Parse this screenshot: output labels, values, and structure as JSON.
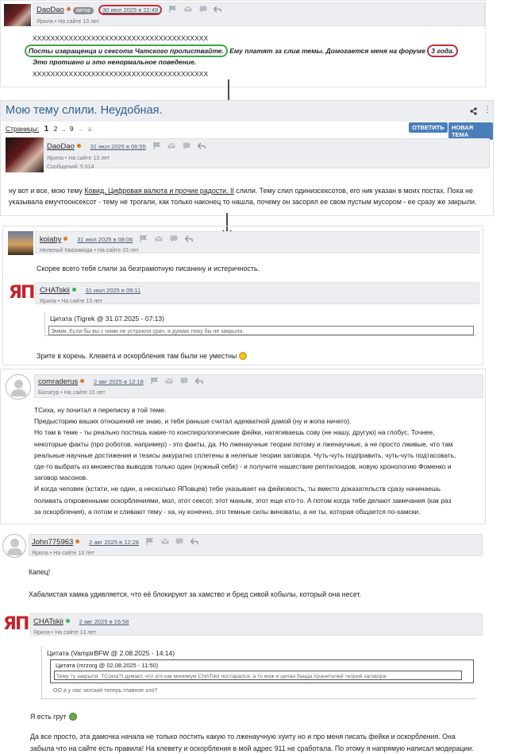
{
  "post1": {
    "username": "DaoDao",
    "badge": "автор",
    "date": "30 июл 2025 в 22:49",
    "rank": "Ярила",
    "member_since": "На сайте 13 лет",
    "x_line_1": "XXXXXXXXXXXXXXXXXXXXXXXXXXXXXXXXXXXXXXX",
    "text_circled": "Посты извращенца и сексота Чатского пролиствайте.",
    "text_rest": " Ему платят за слив темы. Домогается меня на форуме ",
    "text_circled_2": "3 года.",
    "text_line_2": "Это противно и это ненормальное поведение.",
    "x_line_2": "XXXXXXXXXXXXXXXXXXXXXXXXXXXXXXXXXXXXXXX"
  },
  "topic": {
    "title": "Мою тему слили. Неудобная.",
    "pages_label": "Страницы:",
    "page_current": "1",
    "page_2": "2",
    "page_dots": "..",
    "page_last": "9",
    "reply_button": "ОТВЕТИТЬ",
    "new_topic_button": "НОВАЯ ТЕМА"
  },
  "post2": {
    "username": "DaoDao",
    "date": "31 июл 2025 в 06:55",
    "rank": "Ярила",
    "member_since": "На сайте 13 лет",
    "messages": "Сообщений: 5 614",
    "text_before_link": "ну вот и все, мою тему ",
    "link": "Ковид, Цифровая валюта и прочие радости. II",
    "text_after_link": " слили. Тему слил одинизсексотов, его ник указан в моих постах. Пока не",
    "text_line_2": "указывала емучтоонсексот - тему не трогали, как только наконец то нашла, почему он засорял ее свом пустым мусором - ее сразу же закрыли."
  },
  "post3": {
    "username": "koiaby",
    "date": "31 июл 2025 в 08:06",
    "rank": "Нелепый Квазимода",
    "member_since": "На сайте 15 лет",
    "text": "Скорее всего тебя слили за безграмотную писанину и истеричность."
  },
  "post4": {
    "username": "CHATskii",
    "date": "31 июл 2025 в 09:11",
    "rank": "Ярила",
    "member_since": "На сайте 13 лет",
    "avatar_text": "ЯП",
    "quote_header": "Цитата (Tigrek @ 31.07.2025 - 07:13)",
    "quote_text": "Эммм. Если бы вы с ними не устроили срач, я думаю тему бы не закрыли.",
    "text": "Зрите в корень. Клевета и оскорбления там были не уместны"
  },
  "post5": {
    "username": "comraderus",
    "date": "2 авг 2025 в 12:18",
    "rank": "Балагур",
    "member_since": "На сайте 10 лет",
    "lines": [
      "ТСиха, ну почитал я переписку в той теме.",
      "Предысторию ваших отношений не знаю, и тебя раньше считал адекватной дамой (ну и жопа ничего).",
      "Но там в теме - ты реально постишь какие-то конспирологические фейки, натягиваешь сову (не нашу, другую) на глобус. Точнее,",
      "некоторые факты (про роботов, например) - это факты, да. Но лженаучные теории потому и лженаучные, а не просто лживые, что там",
      "реальные научные достижения и тезисы аккуратно сплетены в нелепые теории заговора. Чуть-чуть подправить, чуть-чуть подтасовать,",
      "где-то выбрать из множества выводов только один (нужный себе) - и получите нашествие рептилоидов, новую хронологию Фоменко и",
      "заговор масонов.",
      "И когда человек (кстати, не один, а несколько ЯПовцев) тебе указывает на фейковость, ты вместо доказательств сразу начинаешь",
      "поливать откровенными оскорблениями, мол, этот сексот, этот маньяк, этот еще кто-то. А потом когда тебе делают замечания (как раз",
      "за оскорбления), а потом и сливают тему - ха, ну конечно, это темные силы виноваты, а не ты, которая общается по-хамски."
    ]
  },
  "post6": {
    "username": "John775963",
    "date": "2 авг 2025 в 12:28",
    "rank": "Ярила",
    "member_since": "На сайте 13 лет",
    "line_1": "Капец!",
    "line_2": "Хабалистая хамка удивляется, что её блокируют за хамство и бред сивой кобылы, который она несет."
  },
  "post7": {
    "username": "CHATskii",
    "date": "2 авг 2025 в 16:58",
    "rank": "Ярила",
    "member_since": "На сайте 13 лет",
    "avatar_text": "ЯП",
    "quote_header": "Цитата (VampirBFW @ 2.08.2025 - 14:14)",
    "inner_quote_header": "Цитата (mrzorg @ 02.08.2025 - 11:50)",
    "inner_quote_text": "Тему ту закрыли. ТС(иха?) думает, что это как минимум CHATskii постарался, а то мож и целая банда Хранителей теорий заговора",
    "quote_text": "ОО а у нас чатский теперь главное зло?",
    "line_1": "Я есть грут",
    "line_2": "Да все просто, эта дамочка начала не только постить какую то лженаучную хуиту но и про меня писать фейки и оскорбления. Она",
    "line_3": "забыла что на сайте есть правила! На клевету и оскорбления в мой адрес 911 не сработала. По этому я напрямую написал модерации."
  }
}
